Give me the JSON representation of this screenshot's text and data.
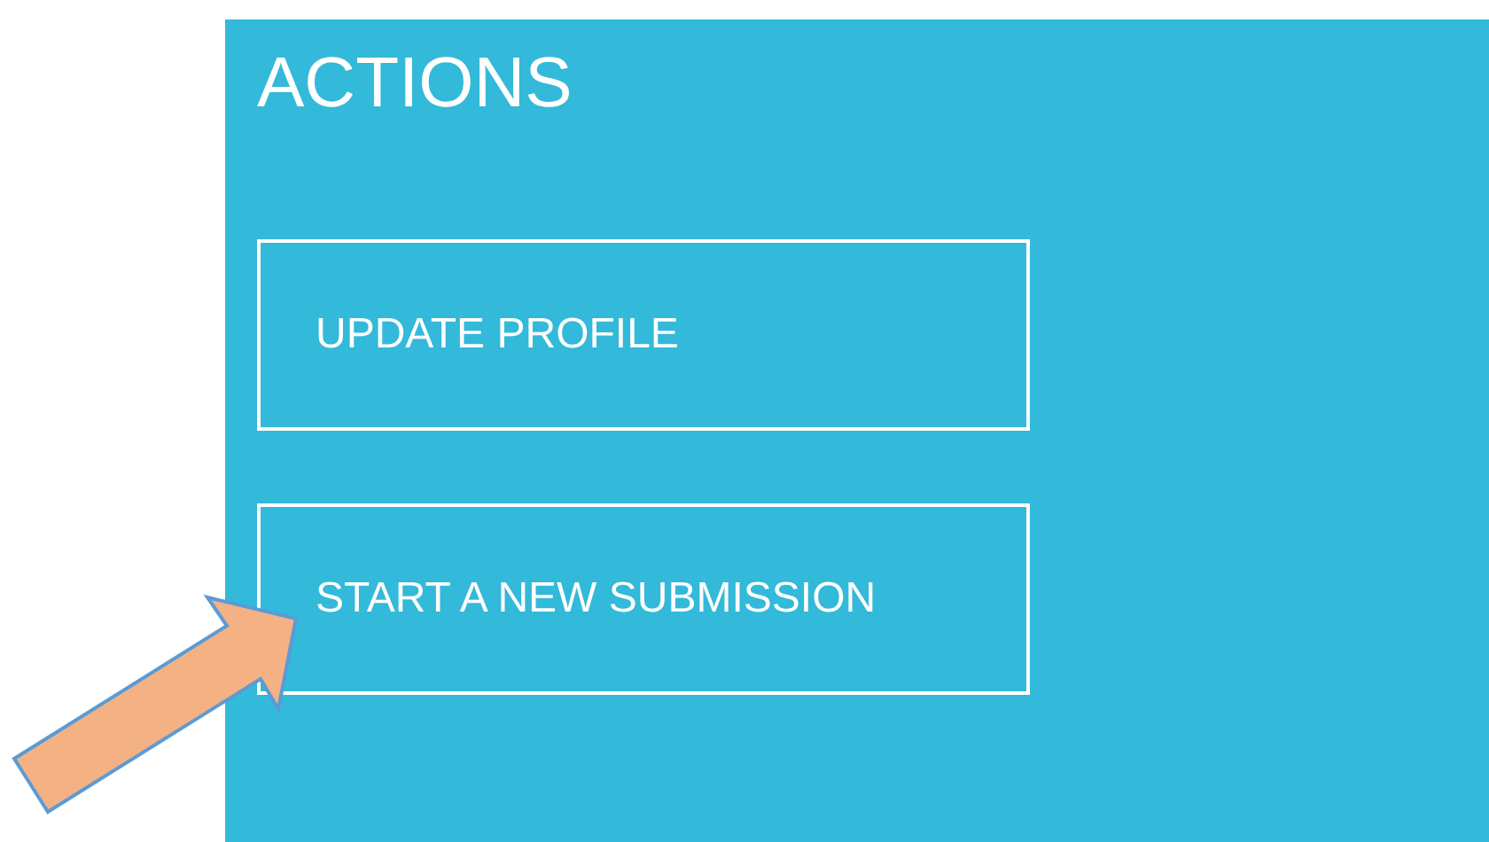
{
  "panel": {
    "title": "ACTIONS",
    "buttons": [
      {
        "label": "UPDATE PROFILE"
      },
      {
        "label": "START A NEW SUBMISSION"
      }
    ]
  }
}
